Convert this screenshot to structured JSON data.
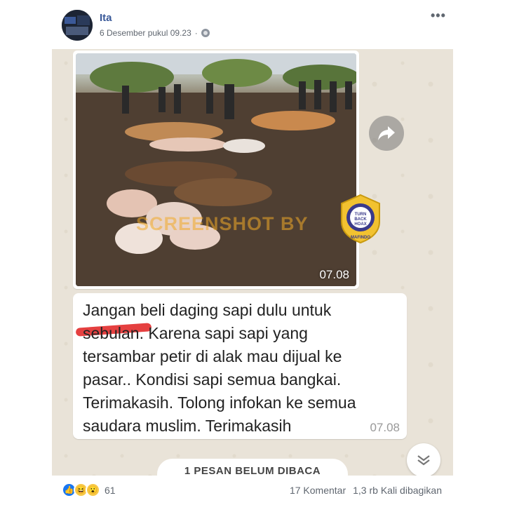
{
  "post": {
    "author": "Ita",
    "timestamp": "6 Desember pukul 09.23",
    "privacy_icon": "globe-icon",
    "more_icon": "more-options-icon"
  },
  "whatsapp": {
    "photo_time": "07.08",
    "watermark": "SCREENSHOT BY",
    "badge_text": "TURN BACK HOAX",
    "badge_org": "MAFINDO",
    "message_lines": [
      "Jangan beli daging sapi dulu untuk",
      "sebulan. Karena sapi sapi yang",
      "tersambar petir di alak mau dijual ke",
      "pasar.. Kondisi sapi semua bangkai.",
      "Terimakasih. Tolong infokan ke semua",
      "saudara muslim. Terimakasih"
    ],
    "message_time": "07.08",
    "unread_label": "1 PESAN BELUM DIBACA",
    "colors": {
      "chat_bg": "#e9e3d8",
      "bubble": "#ffffff",
      "highlight": "#e11e1e"
    }
  },
  "footer": {
    "reaction_icons": [
      "like-icon",
      "haha-icon",
      "wow-icon"
    ],
    "reaction_count": "61",
    "comments": "17 Komentar",
    "shares": "1,3 rb Kali dibagikan"
  }
}
